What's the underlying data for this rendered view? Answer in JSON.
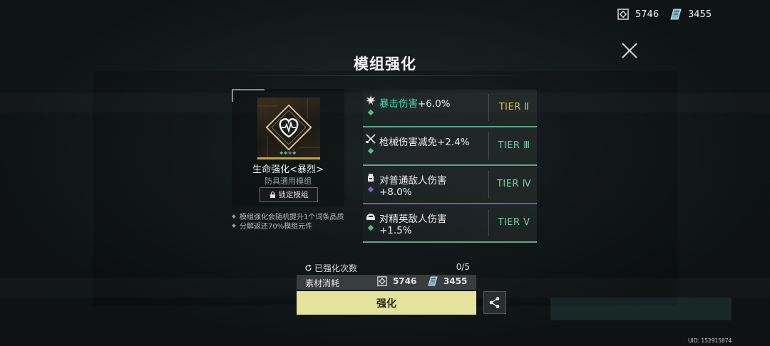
{
  "currency": {
    "a": "5746",
    "b": "3455"
  },
  "title": "模组强化",
  "module": {
    "name": "生命强化<暴烈>",
    "subtitle": "防具通用模组",
    "lock_label": "锁定模组",
    "notes": [
      "模组强化会随机提升1个词条品质",
      "分解返还70%模组元件"
    ]
  },
  "attributes": [
    {
      "highlight": "暴击伤害",
      "text": "+6.0%",
      "tier": "TIER Ⅱ",
      "tier_color": "#d6b94a",
      "gem_color": "#58b889",
      "bar_color": "#5ea889",
      "icon": "burst-icon"
    },
    {
      "highlight": "",
      "text": "枪械伤害减免+2.4%",
      "tier": "TIER Ⅲ",
      "tier_color": "#6cd5a9",
      "gem_color": "#58b889",
      "bar_color": "#5ea889",
      "icon": "crossed-guns-icon"
    },
    {
      "highlight": "",
      "text": "对普通敌人伤害+8.0%",
      "tier": "TIER Ⅳ",
      "tier_color": "#6cd5a9",
      "gem_color": "#8a5cc8",
      "bar_color": "#7e57c2",
      "icon": "grunt-icon"
    },
    {
      "highlight": "",
      "text": "对精英敌人伤害+1.5%",
      "tier": "TIER Ⅴ",
      "tier_color": "#6cd5a9",
      "gem_color": "#58b889",
      "bar_color": "#5ea889",
      "icon": "elite-helmet-icon"
    }
  ],
  "enhance_count": {
    "label": "已强化次数",
    "value": "0/5"
  },
  "cost": {
    "label": "素材消耗",
    "a": "5746",
    "b": "3455"
  },
  "enhance_button": "强化",
  "uid": "UID: 152915874"
}
